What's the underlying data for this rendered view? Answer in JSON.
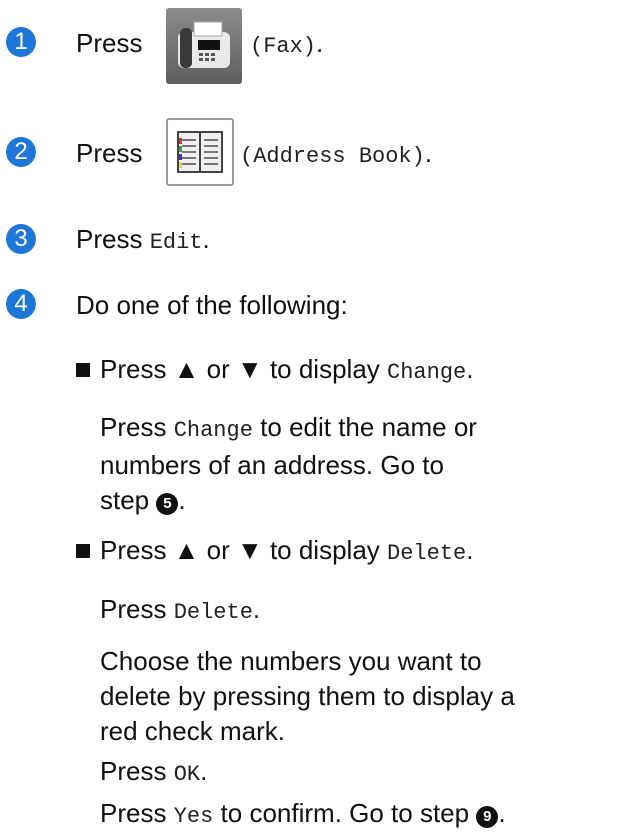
{
  "steps": [
    {
      "num": "1",
      "pre": "Press",
      "code": "(Fax)",
      "post": ".",
      "icon": "fax-icon"
    },
    {
      "num": "2",
      "pre": "Press",
      "code": "(Address Book)",
      "post": ").",
      "icon": "address-book-icon"
    },
    {
      "num": "3",
      "pre": "Press",
      "code": "Edit",
      "post": "."
    },
    {
      "num": "4",
      "text": "Do one of the following:"
    }
  ],
  "bullets": [
    {
      "pre": "Press ▲ or ▼ to display",
      "code": "Change",
      "post": ".",
      "desc_pre": "Press",
      "desc_code": "Change",
      "desc_post": "to edit the name or",
      "desc_line2": "numbers of an address. Go to",
      "desc_line3": "step",
      "step_ref": "5"
    },
    {
      "pre": "Press ▲ or ▼ to display",
      "code": "Delete",
      "post": ".",
      "p1_pre": "Press",
      "p1_code": "Delete",
      "p1_post": ".",
      "p2_line1": "Choose the numbers you want to",
      "p2_line2": "delete by pressing them to display a",
      "p2_line3": "red check mark.",
      "p3_pre": "Press",
      "p3_code": "OK",
      "p3_post": ".",
      "p4_pre": "Press",
      "p4_code": "Yes",
      "p4_mid": "to confirm. Go to step",
      "step_ref": "9"
    }
  ],
  "colors": {
    "step_circle": "#1e77d8"
  }
}
